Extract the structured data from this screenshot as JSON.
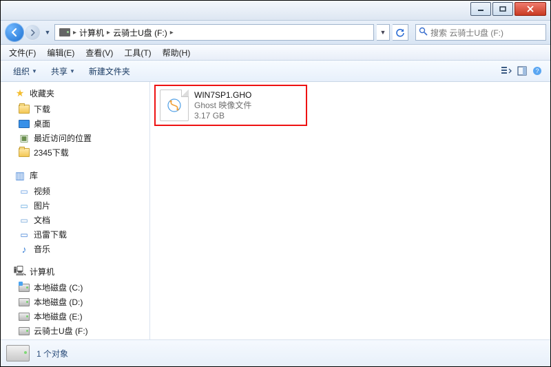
{
  "titlebar": {},
  "nav": {
    "crumb_root": "计算机",
    "crumb_current": "云骑士U盘 (F:)",
    "search_placeholder": "搜索 云骑士U盘 (F:)"
  },
  "menu": {
    "file": "文件(F)",
    "edit": "编辑(E)",
    "view": "查看(V)",
    "tools": "工具(T)",
    "help": "帮助(H)"
  },
  "toolbar": {
    "organize": "组织",
    "share": "共享",
    "new_folder": "新建文件夹"
  },
  "tree": {
    "favorites": {
      "label": "收藏夹",
      "items": [
        "下载",
        "桌面",
        "最近访问的位置",
        "2345下载"
      ]
    },
    "libraries": {
      "label": "库",
      "items": [
        "视频",
        "图片",
        "文档",
        "迅雷下载",
        "音乐"
      ]
    },
    "computer": {
      "label": "计算机",
      "items": [
        "本地磁盘 (C:)",
        "本地磁盘 (D:)",
        "本地磁盘 (E:)",
        "云骑士U盘 (F:)"
      ]
    }
  },
  "files": [
    {
      "name": "WIN7SP1.GHO",
      "type": "Ghost 映像文件",
      "size": "3.17 GB",
      "highlight": true
    }
  ],
  "status": {
    "count_text": "1 个对象"
  }
}
